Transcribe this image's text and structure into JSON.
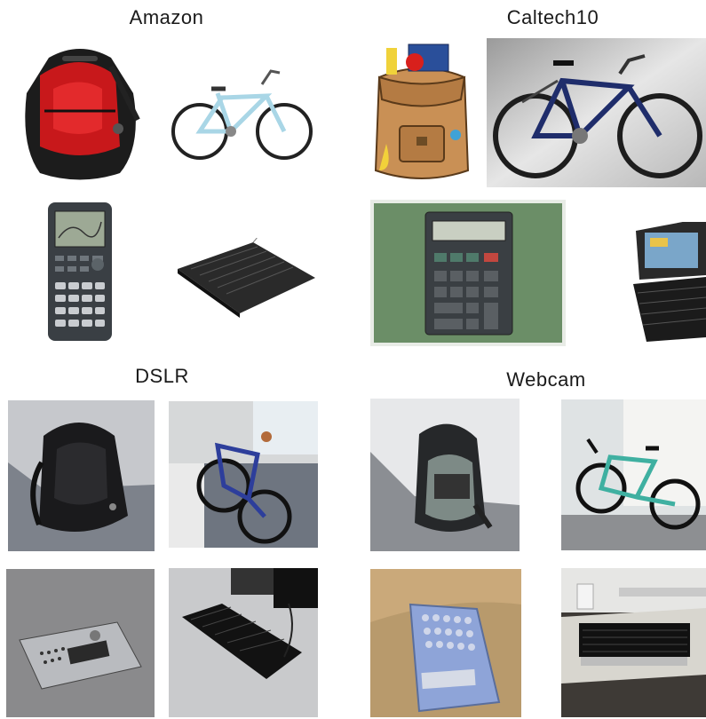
{
  "domains": [
    {
      "title": "Amazon",
      "images": [
        "backpack",
        "bike",
        "calculator",
        "keyboard"
      ]
    },
    {
      "title": "Caltech10",
      "images": [
        "backpack",
        "bike",
        "calculator",
        "keyboard"
      ]
    },
    {
      "title": "DSLR",
      "images": [
        "backpack",
        "bike",
        "calculator",
        "keyboard"
      ]
    },
    {
      "title": "Webcam",
      "images": [
        "backpack",
        "bike",
        "calculator",
        "keyboard"
      ]
    }
  ]
}
